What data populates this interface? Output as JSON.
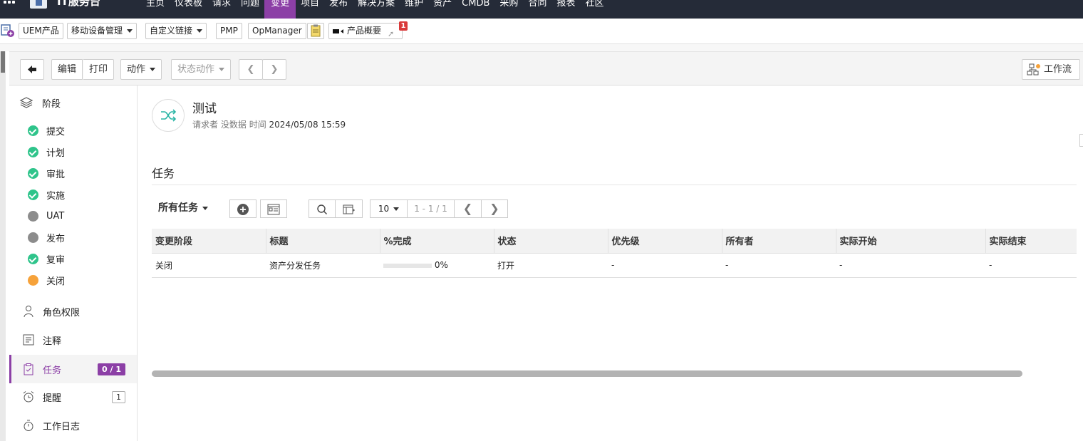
{
  "topnav": {
    "brand": "IT服务台",
    "items": [
      "主页",
      "仪表板",
      "请求",
      "问题",
      "变更",
      "项目",
      "发布",
      "解决方案",
      "维护",
      "资产",
      "CMDB",
      "采购",
      "合同",
      "报表",
      "社区"
    ],
    "active": "变更"
  },
  "quickbar": {
    "uem": "UEM产品",
    "mdm": "移动设备管理",
    "custom_links": "自定义链接",
    "pmp": "PMP",
    "opmanager": "OpManager",
    "product_overview": "产品概要",
    "notification_count": "1"
  },
  "actionbar": {
    "edit": "编辑",
    "print": "打印",
    "actions": "动作",
    "status_actions": "状态动作",
    "workflow": "工作流"
  },
  "sidebar": {
    "stages_title": "阶段",
    "stages": [
      {
        "label": "提交",
        "status": "done"
      },
      {
        "label": "计划",
        "status": "done"
      },
      {
        "label": "审批",
        "status": "done"
      },
      {
        "label": "实施",
        "status": "done"
      },
      {
        "label": "UAT",
        "status": "pending"
      },
      {
        "label": "发布",
        "status": "pending"
      },
      {
        "label": "复审",
        "status": "done"
      },
      {
        "label": "关闭",
        "status": "current"
      }
    ],
    "roles": "角色权限",
    "notes": "注释",
    "tasks": "任务",
    "tasks_count": "0 / 1",
    "reminders": "提醒",
    "reminders_count": "1",
    "worklog": "工作日志"
  },
  "request": {
    "title": "测试",
    "requester_label": "请求者",
    "requester": "没数据",
    "time_label": "时间",
    "time": "2024/05/08 15:59"
  },
  "tasks_section": {
    "title": "任务",
    "filter": "所有任务",
    "page_size": "10",
    "range": "1 - 1 / 1",
    "columns": [
      "变更阶段",
      "标题",
      "%完成",
      "状态",
      "优先级",
      "所有者",
      "实际开始",
      "实际结束"
    ],
    "rows": [
      {
        "stage": "关闭",
        "title": "资产分发任务",
        "percent": "0%",
        "progress": 0,
        "status": "打开",
        "priority": "-",
        "owner": "-",
        "start": "-",
        "end": "-"
      }
    ]
  },
  "colors": {
    "accent": "#8c3fa6",
    "nav_bg": "#252b38",
    "done": "#2fc48b",
    "pending": "#8c8c8c",
    "current": "#f6a23a"
  }
}
